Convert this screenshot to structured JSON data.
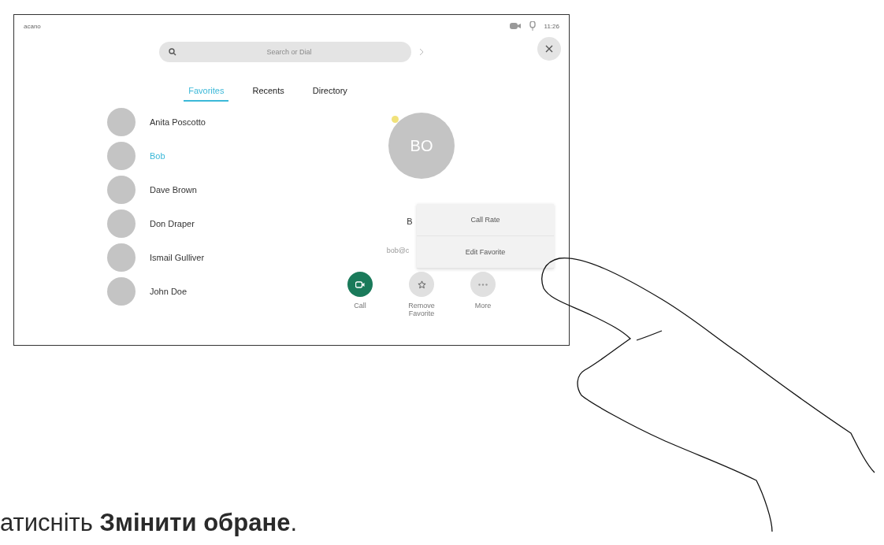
{
  "status_bar": {
    "device": "acano",
    "time": "11:26"
  },
  "search": {
    "placeholder": "Search or Dial"
  },
  "tabs": [
    {
      "label": "Favorites",
      "selected": true
    },
    {
      "label": "Recents",
      "selected": false
    },
    {
      "label": "Directory",
      "selected": false
    }
  ],
  "contacts": [
    {
      "name": "Anita Poscotto",
      "selected": false
    },
    {
      "name": "Bob",
      "selected": true
    },
    {
      "name": "Dave Brown",
      "selected": false
    },
    {
      "name": "Don Draper",
      "selected": false
    },
    {
      "name": "Ismail Gulliver",
      "selected": false
    },
    {
      "name": "John Doe",
      "selected": false
    }
  ],
  "detail": {
    "initials": "BO",
    "name": "B",
    "address": "bob@c",
    "actions": [
      {
        "kind": "call",
        "label": "Call"
      },
      {
        "kind": "favorite",
        "label": "Remove Favorite"
      },
      {
        "kind": "more",
        "label": "More"
      }
    ]
  },
  "menu": [
    "Call Rate",
    "Edit Favorite"
  ],
  "caption": "атисніть **Змінити обране**."
}
